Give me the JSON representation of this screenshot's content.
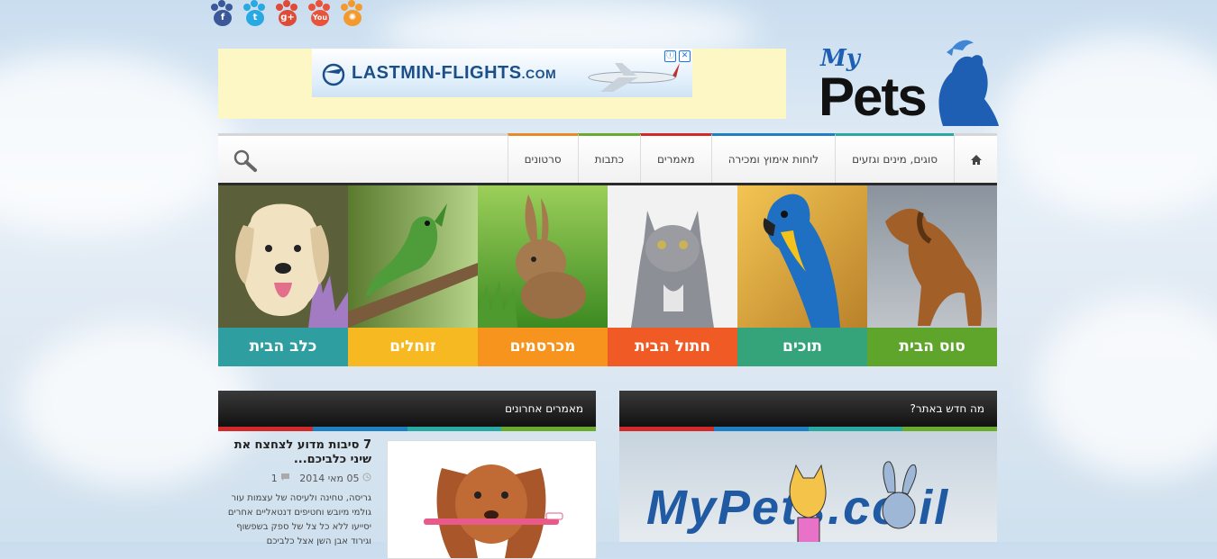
{
  "socials": [
    {
      "name": "facebook",
      "glyph": "f",
      "color": "#3b5998"
    },
    {
      "name": "twitter",
      "glyph": "t",
      "color": "#29a9e1"
    },
    {
      "name": "google-plus",
      "glyph": "g+",
      "color": "#dd4b39"
    },
    {
      "name": "youtube",
      "glyph": "You",
      "color": "#e8533a"
    },
    {
      "name": "rss",
      "glyph": "✺",
      "color": "#f39a2e"
    }
  ],
  "ad": {
    "brand": "LASTMIN-FLIGHTS",
    "tld": ".COM",
    "info_icon": "ⓘ",
    "close_icon": "✕"
  },
  "logo": {
    "my": "My",
    "pets": "Pets"
  },
  "nav": {
    "home_icon": "home-icon",
    "items": [
      {
        "label": "סוגים, מינים וגזעים",
        "color": "#2aa9a2"
      },
      {
        "label": "לוחות אימוץ ומכירה",
        "color": "#1e7fc3"
      },
      {
        "label": "מאמרים",
        "color": "#d22a2a"
      },
      {
        "label": "כתבות",
        "color": "#6aab2e"
      },
      {
        "label": "סרטונים",
        "color": "#e88a2a"
      }
    ],
    "search_icon": "search-icon"
  },
  "categories": [
    {
      "label": "סוס הבית",
      "color": "#5fa52b",
      "img": "horse"
    },
    {
      "label": "תוכים",
      "color": "#35a47b",
      "img": "parrot"
    },
    {
      "label": "חתול הבית",
      "color": "#f05a24",
      "img": "cat"
    },
    {
      "label": "מכרסמים",
      "color": "#f7941d",
      "img": "rabbit"
    },
    {
      "label": "זוחלים",
      "color": "#f6b921",
      "img": "iguana"
    },
    {
      "label": "כלב הבית",
      "color": "#2f9ea0",
      "img": "dog"
    }
  ],
  "widgets": {
    "latest": {
      "title": "מאמרים אחרונים",
      "post": {
        "title": "7 סיבות מדוע לצחצח את שיני כלביכם...",
        "date": "05 מאי 2014",
        "comments": "1",
        "excerpt": "גריסה, טחינה ולעיסה של עצמות עור גולמי מיובש וחטיפים דנטאליים אחרים יסייעו ללא כל צל של ספק בשפשוף וגירוד אבן השן אצל כלביכם"
      }
    },
    "whats_new": {
      "title": "מה חדש באתר?",
      "banner_text": "MyPets.co.il"
    }
  },
  "stripe_colors": [
    "#d22a2a",
    "#1e7fc3",
    "#2aa9a2",
    "#6aab2e"
  ]
}
